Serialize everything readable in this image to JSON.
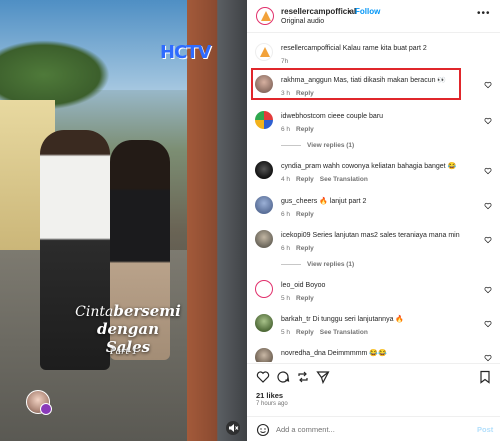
{
  "video": {
    "watermark": "HCTV",
    "caption_prefix": "Cinta",
    "caption_main": "bersemi dengan",
    "caption_line2": "Sales",
    "caption_part": "Part 1"
  },
  "header": {
    "username": "resellercampofficial",
    "follow_separator": "•",
    "follow_label": "Follow",
    "audio": "Original audio",
    "more": "•••"
  },
  "comments": [
    {
      "user": "resellercampofficial",
      "text": "Kalau rame kita buat part 2",
      "time": "7h",
      "reply": "",
      "translate": "",
      "avatar_color": "#ffffff"
    },
    {
      "user": "rakhma_anggun",
      "text": "Mas, tiati dikasih makan beracun 👀",
      "time": "3 h",
      "reply": "Reply",
      "translate": "",
      "avatar_color": "#8a6d62"
    },
    {
      "user": "idwebhostcom",
      "text": "cieee couple baru",
      "time": "6 h",
      "reply": "Reply",
      "translate": "",
      "avatar_color": "#2f5fd0"
    },
    {
      "user": "cyndia_pram",
      "text": "wahh cowonya keliatan bahagia banget 😂",
      "time": "4 h",
      "reply": "Reply",
      "translate": "See Translation",
      "avatar_color": "#2a2a2a"
    },
    {
      "user": "gus_cheers",
      "text": "🔥 lanjut part 2",
      "time": "6 h",
      "reply": "Reply",
      "translate": "",
      "avatar_color": "#6a7fa8"
    },
    {
      "user": "icekopi09",
      "text": "Series lanjutan mas2 sales teraniaya mana min",
      "time": "6 h",
      "reply": "Reply",
      "translate": "",
      "avatar_color": "#7c7a6f"
    },
    {
      "user": "leo_oid",
      "text": "Boyoo",
      "time": "5 h",
      "reply": "Reply",
      "translate": "",
      "avatar_color": "#ffffff"
    },
    {
      "user": "barkah_tr",
      "text": "Di tunggu seri lanjutannya 🔥",
      "time": "5 h",
      "reply": "Reply",
      "translate": "See Translation",
      "avatar_color": "#6b8a4f"
    },
    {
      "user": "novredha_dna",
      "text": "Deimmmmm 😂😂",
      "time": "",
      "reply": "",
      "translate": "",
      "avatar_color": "#8a7c6d"
    }
  ],
  "view_replies": [
    "View replies (1)",
    "View replies (1)"
  ],
  "footer": {
    "likes": "21 likes",
    "ago": "7 hours ago",
    "add_placeholder": "Add a comment...",
    "post_label": "Post"
  },
  "colors": {
    "highlight": "#e0262b",
    "follow": "#0095f6",
    "muted": "#737373"
  }
}
